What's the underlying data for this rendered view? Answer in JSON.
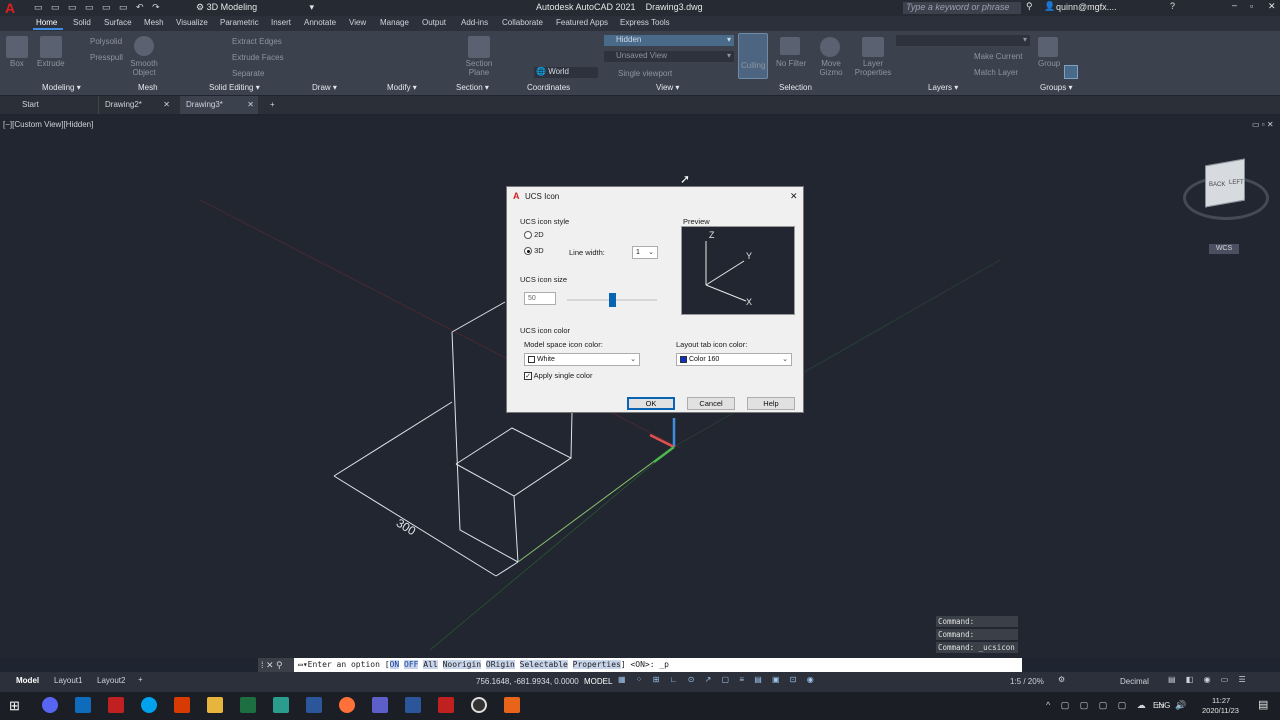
{
  "window": {
    "title": "Autodesk AutoCAD 2021    Drawing3.dwg",
    "workspace": "3D Modeling",
    "search_placeholder": "Type a keyword or phrase",
    "user": "quinn@mgfx...."
  },
  "ribbon_tabs": [
    "Home",
    "Solid",
    "Surface",
    "Mesh",
    "Visualize",
    "Parametric",
    "Insert",
    "Annotate",
    "View",
    "Manage",
    "Output",
    "Add-ins",
    "Collaborate",
    "Featured Apps",
    "Express Tools"
  ],
  "ribbon": {
    "panels": [
      "Modeling",
      "Mesh",
      "Solid Editing",
      "Draw",
      "Modify",
      "Section",
      "Coordinates",
      "View",
      "Selection",
      "Layers",
      "Groups"
    ],
    "buttons": {
      "box": "Box",
      "extrude": "Extrude",
      "polysolid": "Polysolid",
      "presspull": "Presspull",
      "smooth_object": "Smooth Object",
      "extract_edges": "Extract Edges",
      "extrude_faces": "Extrude Faces",
      "separate": "Separate",
      "section_plane": "Section Plane",
      "world": "World",
      "visual_style": "Hidden",
      "view": "Unsaved View",
      "viewport": "Single viewport",
      "culling": "Culling",
      "no_filter": "No Filter",
      "move_gizmo": "Move Gizmo",
      "layer_properties": "Layer Properties",
      "make_current": "Make Current",
      "match_layer": "Match Layer",
      "group": "Group"
    }
  },
  "doc_tabs": [
    "Start",
    "Drawing2*",
    "Drawing3*"
  ],
  "viewport_label": "[−][Custom View][Hidden]",
  "viewcube": {
    "wcs": "WCS",
    "faces": [
      "BACK",
      "LEFT"
    ]
  },
  "drawing": {
    "dimension": "300"
  },
  "dialog": {
    "title": "UCS Icon",
    "style_group": "UCS icon style",
    "opt_2d": "2D",
    "opt_3d": "3D",
    "style_selected": "3D",
    "line_width_label": "Line width:",
    "line_width": "1",
    "preview_label": "Preview",
    "preview_axes": [
      "Z",
      "Y",
      "X"
    ],
    "size_group": "UCS icon size",
    "size_value": "50",
    "size_slider_fraction": 0.5,
    "color_group": "UCS icon color",
    "model_color_label": "Model space icon color:",
    "model_color": "White",
    "layout_color_label": "Layout tab icon color:",
    "layout_color": "Color 160",
    "single_color_label": "Apply single color",
    "single_color_checked": true,
    "ok": "OK",
    "cancel": "Cancel",
    "help": "Help",
    "accent": "#0a64b4"
  },
  "command": {
    "history": [
      "Command:",
      "Command:",
      "Command:  _ucsicon"
    ],
    "prompt": "Enter an option [",
    "options": [
      "ON",
      "OFF",
      "All",
      "Noorigin",
      "ORigin",
      "Selectable",
      "Properties"
    ],
    "prompt_tail": "] <ON>: _p"
  },
  "status": {
    "layout_tabs": [
      "Model",
      "Layout1",
      "Layout2"
    ],
    "coords": "756.1648, -681.9934, 0.0000",
    "space": "MODEL",
    "scale": "1:5 / 20%",
    "units": "Decimal"
  },
  "taskbar": {
    "time": "11:27",
    "date": "2020/11/23",
    "lang": "ENG"
  }
}
